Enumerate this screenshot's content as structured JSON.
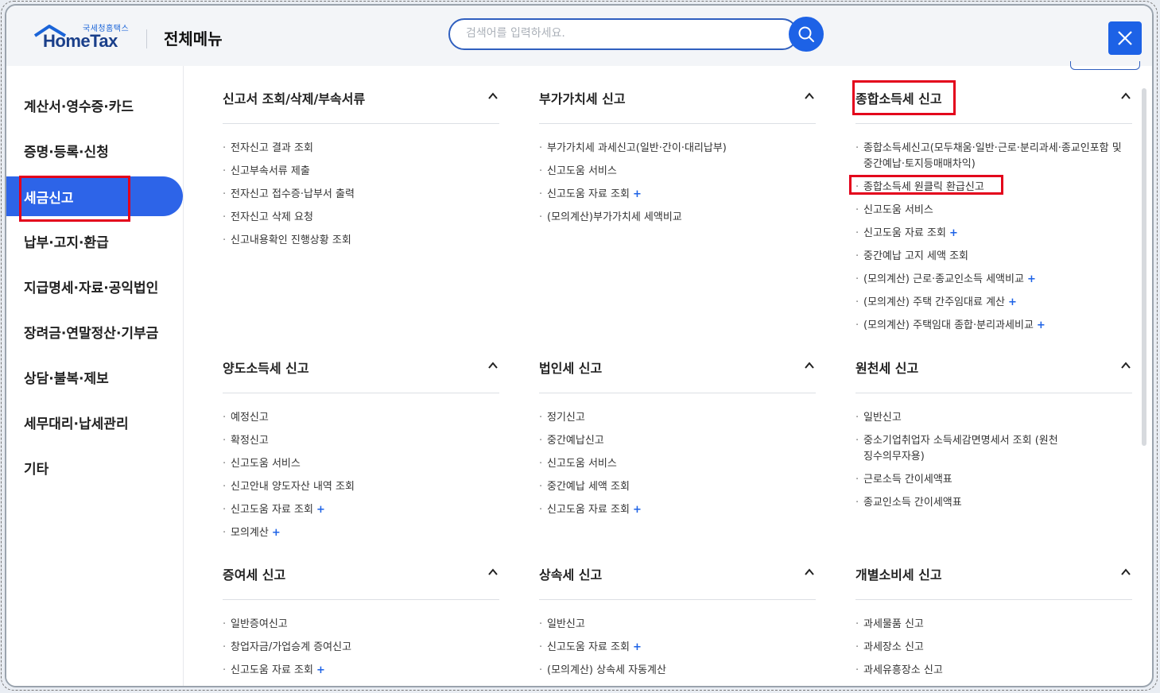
{
  "header": {
    "logo_sub": "국세청홈택스",
    "logo_main": "HomeTax",
    "title": "전체메뉴",
    "search_placeholder": "검색어를 입력하세요."
  },
  "sidebar": {
    "items": [
      {
        "label": "계산서·영수증·카드"
      },
      {
        "label": "증명·등록·신청"
      },
      {
        "label": "세금신고"
      },
      {
        "label": "납부·고지·환급"
      },
      {
        "label": "지급명세·자료·공익법인"
      },
      {
        "label": "장려금·연말정산·기부금"
      },
      {
        "label": "상담·불복·제보"
      },
      {
        "label": "세무대리·납세관리"
      },
      {
        "label": "기타"
      }
    ],
    "active_index": 2
  },
  "sections": [
    {
      "title": "신고서 조회/삭제/부속서류",
      "items": [
        {
          "label": "전자신고 결과 조회"
        },
        {
          "label": "신고부속서류 제출"
        },
        {
          "label": "전자신고 접수증·납부서 출력"
        },
        {
          "label": "전자신고 삭제 요청"
        },
        {
          "label": "신고내용확인 진행상황 조회"
        }
      ]
    },
    {
      "title": "부가가치세 신고",
      "items": [
        {
          "label": "부가가치세 과세신고(일반·간이·대리납부)"
        },
        {
          "label": "신고도움 서비스"
        },
        {
          "label": "신고도움 자료 조회",
          "plus": "+"
        },
        {
          "label": "(모의계산)부가가치세 세액비교"
        }
      ]
    },
    {
      "title": "종합소득세 신고",
      "items": [
        {
          "label": "종합소득세신고(모두채움·일반·근로·분리과세·종교인포함 및 중간예납·토지등매매차익)"
        },
        {
          "label": "종합소득세 원클릭 환급신고"
        },
        {
          "label": "신고도움 서비스"
        },
        {
          "label": "신고도움 자료 조회",
          "plus": "+"
        },
        {
          "label": "중간예납 고지 세액 조회"
        },
        {
          "label": "(모의계산) 근로·종교인소득 세액비교",
          "plus": "+"
        },
        {
          "label": "(모의계산) 주택 간주임대료 계산",
          "plus": "+"
        },
        {
          "label": "(모의계산) 주택임대 종합·분리과세비교",
          "plus": "+"
        }
      ]
    },
    {
      "title": "양도소득세 신고",
      "items": [
        {
          "label": "예정신고"
        },
        {
          "label": "확정신고"
        },
        {
          "label": "신고도움 서비스"
        },
        {
          "label": "신고안내 양도자산 내역 조회"
        },
        {
          "label": "신고도움 자료 조회",
          "plus": "+"
        },
        {
          "label": "모의계산",
          "plus": "+"
        }
      ]
    },
    {
      "title": "법인세 신고",
      "items": [
        {
          "label": "정기신고"
        },
        {
          "label": "중간예납신고"
        },
        {
          "label": "신고도움 서비스"
        },
        {
          "label": "중간예납 세액 조회"
        },
        {
          "label": "신고도움 자료 조회",
          "plus": "+"
        }
      ]
    },
    {
      "title": "원천세 신고",
      "items": [
        {
          "label": "일반신고"
        },
        {
          "label": "중소기업취업자 소득세감면명세서 조회 (원천징수의무자용)"
        },
        {
          "label": "근로소득 간이세액표"
        },
        {
          "label": "종교인소득 간이세액표"
        }
      ]
    },
    {
      "title": "증여세 신고",
      "items": [
        {
          "label": "일반증여신고"
        },
        {
          "label": "창업자금/가업승계 증여신고"
        },
        {
          "label": "신고도움 자료 조회",
          "plus": "+"
        }
      ]
    },
    {
      "title": "상속세 신고",
      "items": [
        {
          "label": "일반신고"
        },
        {
          "label": "신고도움 자료 조회",
          "plus": "+"
        },
        {
          "label": "(모의계산) 상속세 자동계산"
        }
      ]
    },
    {
      "title": "개별소비세 신고",
      "items": [
        {
          "label": "과세물품 신고"
        },
        {
          "label": "과세장소 신고"
        },
        {
          "label": "과세유흥장소 신고"
        }
      ]
    }
  ]
}
